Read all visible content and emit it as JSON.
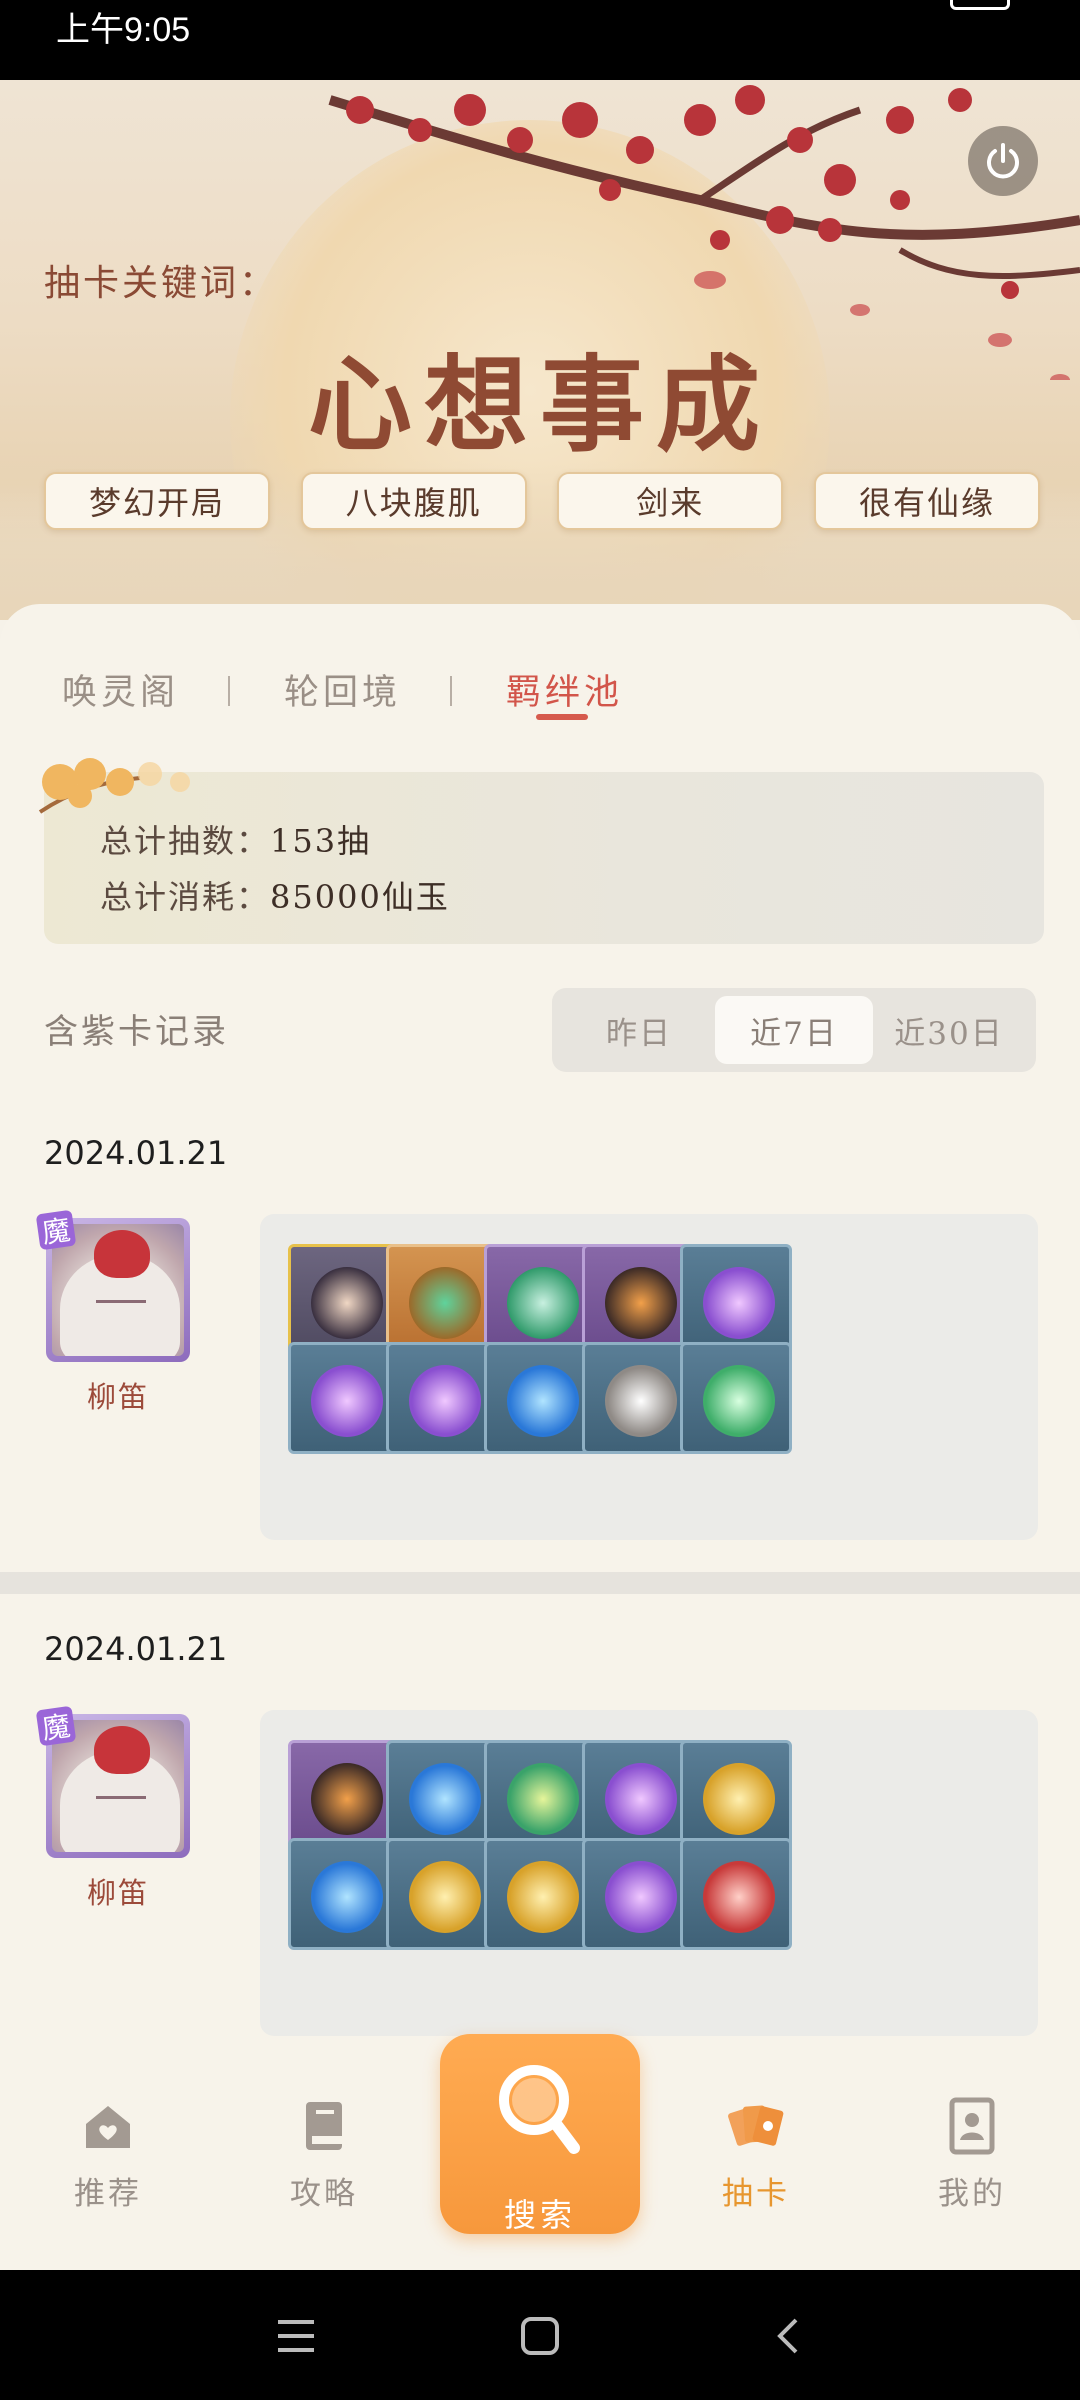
{
  "status_bar": {
    "time": "上午9:05"
  },
  "hero": {
    "keyword_label": "抽卡关键词：",
    "keyword": "心想事成",
    "tags": [
      "梦幻开局",
      "八块腹肌",
      "剑来",
      "很有仙缘"
    ]
  },
  "tabs": {
    "items": [
      "唤灵阁",
      "轮回境",
      "羁绊池"
    ],
    "active": "羁绊池"
  },
  "stats": {
    "total_draws_label": "总计抽数：",
    "total_draws_value": "153抽",
    "total_cost_label": "总计消耗：",
    "total_cost_value": "85000仙玉"
  },
  "records": {
    "title": "含紫卡记录",
    "filter_options": [
      "昨日",
      "近7日",
      "近30日"
    ],
    "active_filter": "近7日",
    "entries": [
      {
        "date": "2024.01.21",
        "character": {
          "name": "柳笛",
          "badge": "魔"
        },
        "items": [
          {
            "rarity": "gold",
            "icon": "character-portrait-icon"
          },
          {
            "rarity": "orange",
            "icon": "treasure-chest-icon"
          },
          {
            "rarity": "purple",
            "icon": "green-lotus-icon"
          },
          {
            "rarity": "purple",
            "icon": "ore-stone-icon"
          },
          {
            "rarity": "blue",
            "icon": "purple-chest-icon"
          },
          {
            "rarity": "blue",
            "icon": "purple-chest-icon"
          },
          {
            "rarity": "blue",
            "icon": "purple-chest-icon"
          },
          {
            "rarity": "blue",
            "icon": "blue-flame-icon"
          },
          {
            "rarity": "blue",
            "icon": "grey-stone-icon"
          },
          {
            "rarity": "blue",
            "icon": "green-chest-icon"
          }
        ]
      },
      {
        "date": "2024.01.21",
        "character": {
          "name": "柳笛",
          "badge": "魔"
        },
        "items": [
          {
            "rarity": "purple",
            "icon": "ore-stone-icon"
          },
          {
            "rarity": "blue",
            "icon": "blue-flame-icon"
          },
          {
            "rarity": "blue",
            "icon": "green-leaf-icon"
          },
          {
            "rarity": "blue",
            "icon": "purple-chest-icon"
          },
          {
            "rarity": "blue",
            "icon": "gold-chest-icon"
          },
          {
            "rarity": "blue",
            "icon": "blue-flame-icon"
          },
          {
            "rarity": "blue",
            "icon": "gold-chest-icon"
          },
          {
            "rarity": "blue",
            "icon": "gold-chest-icon"
          },
          {
            "rarity": "blue",
            "icon": "purple-chest-icon"
          },
          {
            "rarity": "blue",
            "icon": "red-chest-icon"
          }
        ]
      }
    ]
  },
  "bottom_nav": {
    "items": [
      "推荐",
      "攻略",
      "搜索",
      "抽卡",
      "我的"
    ],
    "active": "抽卡"
  },
  "colors": {
    "accent": "#f7983c",
    "tab_active": "#d2554a",
    "title": "#8f4a33"
  }
}
